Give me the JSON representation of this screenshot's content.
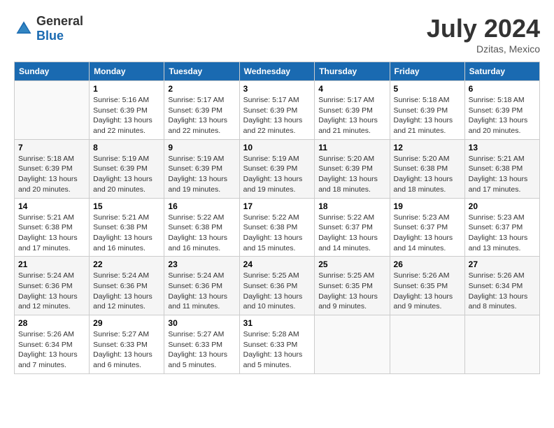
{
  "header": {
    "logo_general": "General",
    "logo_blue": "Blue",
    "title": "July 2024",
    "location": "Dzitas, Mexico"
  },
  "days_of_week": [
    "Sunday",
    "Monday",
    "Tuesday",
    "Wednesday",
    "Thursday",
    "Friday",
    "Saturday"
  ],
  "weeks": [
    [
      {
        "day": "",
        "sunrise": "",
        "sunset": "",
        "daylight": ""
      },
      {
        "day": "1",
        "sunrise": "Sunrise: 5:16 AM",
        "sunset": "Sunset: 6:39 PM",
        "daylight": "Daylight: 13 hours and 22 minutes."
      },
      {
        "day": "2",
        "sunrise": "Sunrise: 5:17 AM",
        "sunset": "Sunset: 6:39 PM",
        "daylight": "Daylight: 13 hours and 22 minutes."
      },
      {
        "day": "3",
        "sunrise": "Sunrise: 5:17 AM",
        "sunset": "Sunset: 6:39 PM",
        "daylight": "Daylight: 13 hours and 22 minutes."
      },
      {
        "day": "4",
        "sunrise": "Sunrise: 5:17 AM",
        "sunset": "Sunset: 6:39 PM",
        "daylight": "Daylight: 13 hours and 21 minutes."
      },
      {
        "day": "5",
        "sunrise": "Sunrise: 5:18 AM",
        "sunset": "Sunset: 6:39 PM",
        "daylight": "Daylight: 13 hours and 21 minutes."
      },
      {
        "day": "6",
        "sunrise": "Sunrise: 5:18 AM",
        "sunset": "Sunset: 6:39 PM",
        "daylight": "Daylight: 13 hours and 20 minutes."
      }
    ],
    [
      {
        "day": "7",
        "sunrise": "Sunrise: 5:18 AM",
        "sunset": "Sunset: 6:39 PM",
        "daylight": "Daylight: 13 hours and 20 minutes."
      },
      {
        "day": "8",
        "sunrise": "Sunrise: 5:19 AM",
        "sunset": "Sunset: 6:39 PM",
        "daylight": "Daylight: 13 hours and 20 minutes."
      },
      {
        "day": "9",
        "sunrise": "Sunrise: 5:19 AM",
        "sunset": "Sunset: 6:39 PM",
        "daylight": "Daylight: 13 hours and 19 minutes."
      },
      {
        "day": "10",
        "sunrise": "Sunrise: 5:19 AM",
        "sunset": "Sunset: 6:39 PM",
        "daylight": "Daylight: 13 hours and 19 minutes."
      },
      {
        "day": "11",
        "sunrise": "Sunrise: 5:20 AM",
        "sunset": "Sunset: 6:39 PM",
        "daylight": "Daylight: 13 hours and 18 minutes."
      },
      {
        "day": "12",
        "sunrise": "Sunrise: 5:20 AM",
        "sunset": "Sunset: 6:38 PM",
        "daylight": "Daylight: 13 hours and 18 minutes."
      },
      {
        "day": "13",
        "sunrise": "Sunrise: 5:21 AM",
        "sunset": "Sunset: 6:38 PM",
        "daylight": "Daylight: 13 hours and 17 minutes."
      }
    ],
    [
      {
        "day": "14",
        "sunrise": "Sunrise: 5:21 AM",
        "sunset": "Sunset: 6:38 PM",
        "daylight": "Daylight: 13 hours and 17 minutes."
      },
      {
        "day": "15",
        "sunrise": "Sunrise: 5:21 AM",
        "sunset": "Sunset: 6:38 PM",
        "daylight": "Daylight: 13 hours and 16 minutes."
      },
      {
        "day": "16",
        "sunrise": "Sunrise: 5:22 AM",
        "sunset": "Sunset: 6:38 PM",
        "daylight": "Daylight: 13 hours and 16 minutes."
      },
      {
        "day": "17",
        "sunrise": "Sunrise: 5:22 AM",
        "sunset": "Sunset: 6:38 PM",
        "daylight": "Daylight: 13 hours and 15 minutes."
      },
      {
        "day": "18",
        "sunrise": "Sunrise: 5:22 AM",
        "sunset": "Sunset: 6:37 PM",
        "daylight": "Daylight: 13 hours and 14 minutes."
      },
      {
        "day": "19",
        "sunrise": "Sunrise: 5:23 AM",
        "sunset": "Sunset: 6:37 PM",
        "daylight": "Daylight: 13 hours and 14 minutes."
      },
      {
        "day": "20",
        "sunrise": "Sunrise: 5:23 AM",
        "sunset": "Sunset: 6:37 PM",
        "daylight": "Daylight: 13 hours and 13 minutes."
      }
    ],
    [
      {
        "day": "21",
        "sunrise": "Sunrise: 5:24 AM",
        "sunset": "Sunset: 6:36 PM",
        "daylight": "Daylight: 13 hours and 12 minutes."
      },
      {
        "day": "22",
        "sunrise": "Sunrise: 5:24 AM",
        "sunset": "Sunset: 6:36 PM",
        "daylight": "Daylight: 13 hours and 12 minutes."
      },
      {
        "day": "23",
        "sunrise": "Sunrise: 5:24 AM",
        "sunset": "Sunset: 6:36 PM",
        "daylight": "Daylight: 13 hours and 11 minutes."
      },
      {
        "day": "24",
        "sunrise": "Sunrise: 5:25 AM",
        "sunset": "Sunset: 6:36 PM",
        "daylight": "Daylight: 13 hours and 10 minutes."
      },
      {
        "day": "25",
        "sunrise": "Sunrise: 5:25 AM",
        "sunset": "Sunset: 6:35 PM",
        "daylight": "Daylight: 13 hours and 9 minutes."
      },
      {
        "day": "26",
        "sunrise": "Sunrise: 5:26 AM",
        "sunset": "Sunset: 6:35 PM",
        "daylight": "Daylight: 13 hours and 9 minutes."
      },
      {
        "day": "27",
        "sunrise": "Sunrise: 5:26 AM",
        "sunset": "Sunset: 6:34 PM",
        "daylight": "Daylight: 13 hours and 8 minutes."
      }
    ],
    [
      {
        "day": "28",
        "sunrise": "Sunrise: 5:26 AM",
        "sunset": "Sunset: 6:34 PM",
        "daylight": "Daylight: 13 hours and 7 minutes."
      },
      {
        "day": "29",
        "sunrise": "Sunrise: 5:27 AM",
        "sunset": "Sunset: 6:33 PM",
        "daylight": "Daylight: 13 hours and 6 minutes."
      },
      {
        "day": "30",
        "sunrise": "Sunrise: 5:27 AM",
        "sunset": "Sunset: 6:33 PM",
        "daylight": "Daylight: 13 hours and 5 minutes."
      },
      {
        "day": "31",
        "sunrise": "Sunrise: 5:28 AM",
        "sunset": "Sunset: 6:33 PM",
        "daylight": "Daylight: 13 hours and 5 minutes."
      },
      {
        "day": "",
        "sunrise": "",
        "sunset": "",
        "daylight": ""
      },
      {
        "day": "",
        "sunrise": "",
        "sunset": "",
        "daylight": ""
      },
      {
        "day": "",
        "sunrise": "",
        "sunset": "",
        "daylight": ""
      }
    ]
  ]
}
